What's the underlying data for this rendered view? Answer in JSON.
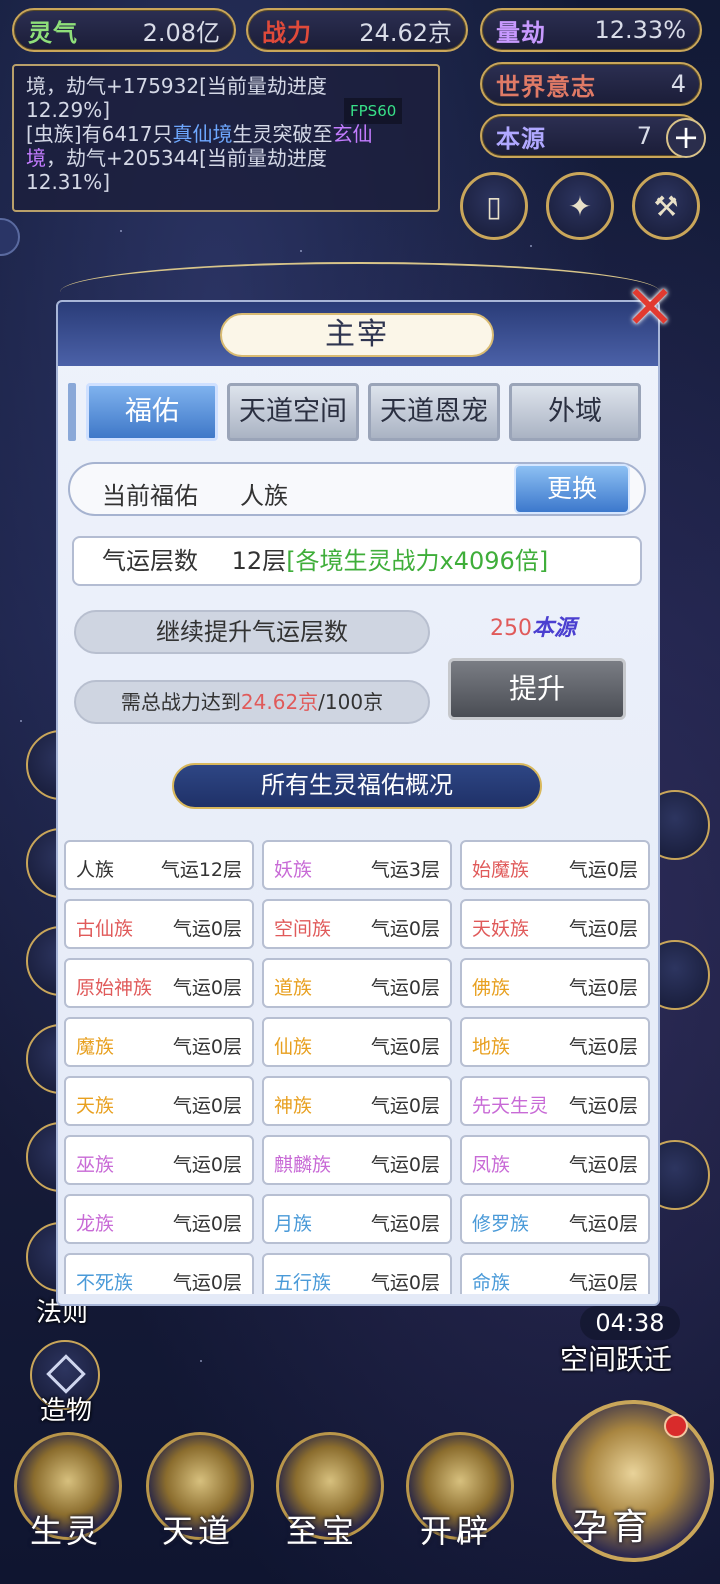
{
  "stats": {
    "lingqi": {
      "label": "灵气",
      "value": "2.08亿",
      "color": "#8fe07a"
    },
    "zhanli": {
      "label": "战力",
      "value": "24.62京",
      "color": "#e04a3a"
    },
    "liangjie": {
      "label": "量劫",
      "value": "12.33%",
      "color": "#c89aff"
    },
    "world_will": {
      "label": "世界意志",
      "value": "4",
      "color": "#e07a66"
    },
    "origin": {
      "label": "本源",
      "value": "7",
      "color": "#b0a8ff",
      "add": "+"
    }
  },
  "log": {
    "line1a": "境，劫气+175932[当前量劫进度",
    "line1b": "12.29%]",
    "fps": "FPS60",
    "line2a_pre": "[虫族]有6417只",
    "line2a_realm1": "真仙境",
    "line2a_mid": "生灵突破至",
    "line2a_realm2": "玄仙",
    "line2b_realm2": "境",
    "line2b_post": "，劫气+205344[当前量劫进度",
    "line2c": "12.31%]"
  },
  "top_buttons": {
    "cards": "▯",
    "spiral": "✦",
    "hammer": "⚒"
  },
  "modal": {
    "title": "主宰",
    "close": "✕",
    "tabs": [
      "福佑",
      "天道空间",
      "天道恩宠",
      "外域"
    ],
    "current_label": "当前福佑",
    "current_value": "人族",
    "swap": "更换",
    "luck_label": "气运层数",
    "luck_level": "12层",
    "luck_bonus": "[各境生灵战力x4096倍]",
    "continue_label": "继续提升气运层数",
    "cost_number": "250",
    "cost_unit": "本源",
    "req_prefix": "需总战力达到",
    "req_current": "24.62京",
    "req_suffix": "/100京",
    "upgrade": "提升",
    "section_title": "所有生灵福佑概况"
  },
  "races": [
    {
      "name": "人族",
      "luck": "气运12层",
      "color": "#333333"
    },
    {
      "name": "妖族",
      "luck": "气运3层",
      "color": "#c86ad6"
    },
    {
      "name": "始魔族",
      "luck": "气运0层",
      "color": "#e05a5a"
    },
    {
      "name": "古仙族",
      "luck": "气运0层",
      "color": "#e05a5a"
    },
    {
      "name": "空间族",
      "luck": "气运0层",
      "color": "#e05a5a"
    },
    {
      "name": "天妖族",
      "luck": "气运0层",
      "color": "#e05a5a"
    },
    {
      "name": "原始神族",
      "luck": "气运0层",
      "color": "#e05a5a"
    },
    {
      "name": "道族",
      "luck": "气运0层",
      "color": "#e8a020"
    },
    {
      "name": "佛族",
      "luck": "气运0层",
      "color": "#e8a020"
    },
    {
      "name": "魔族",
      "luck": "气运0层",
      "color": "#e8a020"
    },
    {
      "name": "仙族",
      "luck": "气运0层",
      "color": "#e8a020"
    },
    {
      "name": "地族",
      "luck": "气运0层",
      "color": "#e8a020"
    },
    {
      "name": "天族",
      "luck": "气运0层",
      "color": "#e8a020"
    },
    {
      "name": "神族",
      "luck": "气运0层",
      "color": "#e8a020"
    },
    {
      "name": "先天生灵",
      "luck": "气运0层",
      "color": "#c86ad6"
    },
    {
      "name": "巫族",
      "luck": "气运0层",
      "color": "#c86ad6"
    },
    {
      "name": "麒麟族",
      "luck": "气运0层",
      "color": "#c86ad6"
    },
    {
      "name": "凤族",
      "luck": "气运0层",
      "color": "#c86ad6"
    },
    {
      "name": "龙族",
      "luck": "气运0层",
      "color": "#c86ad6"
    },
    {
      "name": "月族",
      "luck": "气运0层",
      "color": "#4a9ad8"
    },
    {
      "name": "修罗族",
      "luck": "气运0层",
      "color": "#4a9ad8"
    },
    {
      "name": "不死族",
      "luck": "气运0层",
      "color": "#4a9ad8"
    },
    {
      "name": "五行族",
      "luck": "气运0层",
      "color": "#4a9ad8"
    },
    {
      "name": "命族",
      "luck": "气运0层",
      "color": "#4a9ad8"
    }
  ],
  "side": {
    "fa_ze": "法则",
    "zao_wu": "造物"
  },
  "warp": {
    "timer": "04:38",
    "label": "空间跃迁"
  },
  "nav": [
    "生灵",
    "天道",
    "至宝",
    "开辟",
    "孕育"
  ]
}
